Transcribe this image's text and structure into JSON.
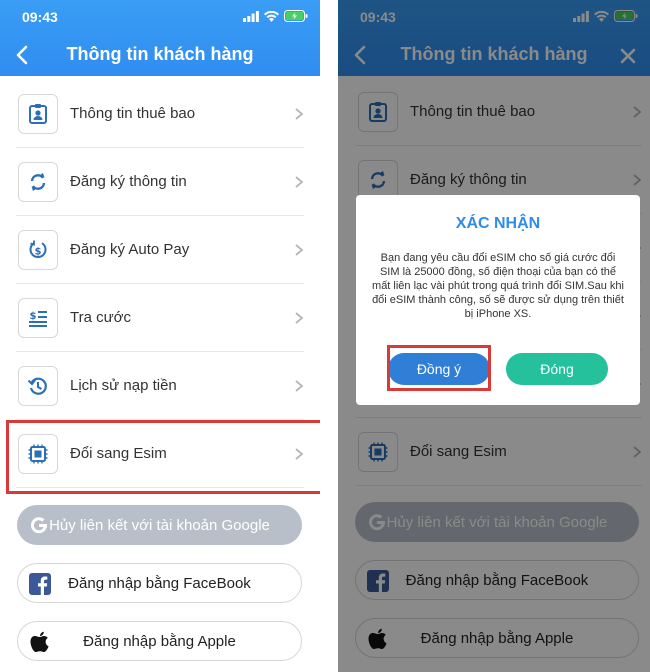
{
  "status_bar": {
    "time": "09:43"
  },
  "header": {
    "title": "Thông tin khách hàng"
  },
  "menu": [
    {
      "label": "Thông tin thuê bao",
      "icon": "id-card-icon"
    },
    {
      "label": "Đăng ký thông tin",
      "icon": "refresh-icon"
    },
    {
      "label": "Đăng ký Auto Pay",
      "icon": "dollar-cycle-icon"
    },
    {
      "label": "Tra cước",
      "icon": "invoice-icon"
    },
    {
      "label": "Lịch sử nạp tiền",
      "icon": "history-icon"
    },
    {
      "label": "Đổi sang Esim",
      "icon": "sim-chip-icon"
    }
  ],
  "buttons": {
    "google": "Hủy liên kết với tài khoản Google",
    "facebook": "Đăng nhập bằng FaceBook",
    "apple": "Đăng nhập bằng Apple"
  },
  "dialog": {
    "title": "XÁC NHẬN",
    "message": "Bạn đang yêu cầu đổi eSIM cho số giá cước đổi SIM là 25000 đồng, số điện thoại của bạn có thể mất liên lạc vài phút trong quá trình đổi SIM.Sau khi đổi eSIM thành công, số sẽ được sử dụng trên thiết bị iPhone XS.",
    "confirm": "Đồng ý",
    "close": "Đóng"
  },
  "colors": {
    "header": "#2f8df0",
    "highlight": "#d83a3a",
    "confirm": "#2f7fd6",
    "close": "#25c19c",
    "dialog_title": "#2f8de8"
  }
}
